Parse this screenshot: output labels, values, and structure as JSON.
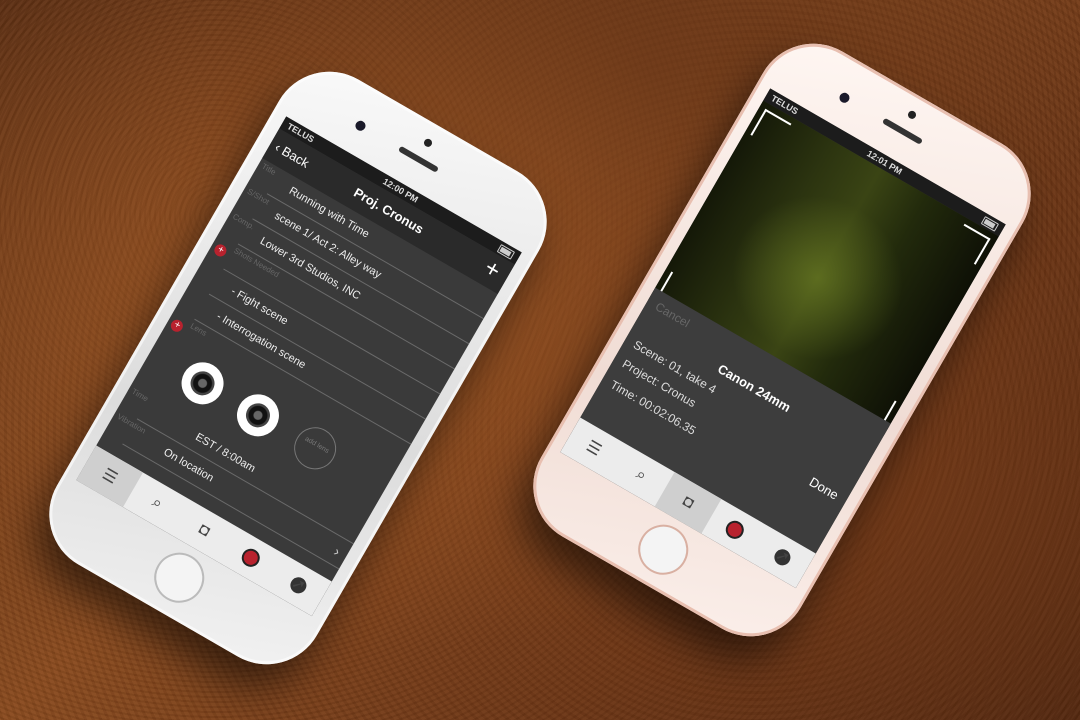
{
  "left_phone": {
    "status": {
      "carrier": "TELUS",
      "time": "12:00 PM"
    },
    "nav": {
      "back_label": "Back",
      "title": "Proj. Cronus",
      "add_label": "+"
    },
    "rows": [
      {
        "label": "Title",
        "value": "Running with Time"
      },
      {
        "label": "S/Shot",
        "value": "scene 1/ Act 2: Alley way"
      },
      {
        "label": "Comp.",
        "value": "Lower 3rd Studios, INC"
      },
      {
        "label": "Shots Needed",
        "value": ""
      },
      {
        "label": "",
        "value": "- Fight scene"
      },
      {
        "label": "",
        "value": "- Interrogation scene"
      },
      {
        "label": "Lens",
        "value": ""
      }
    ],
    "add_lens_label": "add lens",
    "time_row": {
      "label": "Time",
      "value": "EST / 8:00am"
    },
    "location_row": {
      "label": "Vibration",
      "value": "On location"
    }
  },
  "right_phone": {
    "status": {
      "carrier": "TELUS",
      "time": "12:01 PM"
    },
    "sheet": {
      "cancel_label": "Cancel",
      "lens_name": "Canon 24mm",
      "done_label": "Done",
      "scene": "Scene: 01, take 4",
      "project": "Project: Cronus",
      "time": "Time: 00:02:06.35"
    }
  },
  "tabs": [
    "list-icon",
    "search-icon",
    "camera-icon",
    "record-icon",
    "compass-icon"
  ],
  "colors": {
    "accent_red": "#b8222e",
    "screen_bg": "#3a3a3a"
  }
}
